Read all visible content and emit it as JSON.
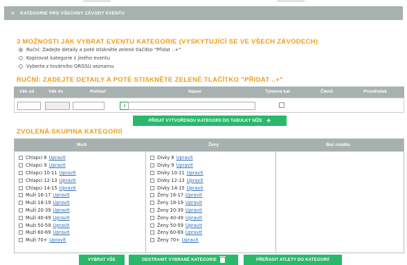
{
  "section": {
    "title": "KATEGORIE PRO VŠECHNY ZÁVODY EVENTU"
  },
  "methods": {
    "heading": "3 MOŽNOSTI JAK VYBRAT EVENTU KATEGORIE (VYSKYTUJÍCÍ SE VE VŠECH ZÁVODECH)",
    "options": [
      {
        "label": "Ruční: Zadejte detaily a poté stiskněte zelené tlačítko \"Přidat ..+\"",
        "checked": true
      },
      {
        "label": "Kopírovat kategorie z jiného eventu",
        "checked": false
      },
      {
        "label": "Vyberte z továrního ORGSU seznamu",
        "checked": false
      }
    ]
  },
  "manual": {
    "heading": "RUČNÍ: ZADEJTE DETAILY A POTÉ STISKNĚTE ZELENÉ TLAČÍTKO \"PŘIDAT ..+\"",
    "columns": [
      "Věk od",
      "Věk do",
      "Pohlaví",
      "Název",
      "Týmová kat",
      "Členů",
      "Prostředek"
    ],
    "add_button": "PŘIDAT VYTVOŘENOU KATEGORII DO TABULKY NÍŽE"
  },
  "selected": {
    "heading": "ZVOLENÁ SKUPINA KATEGORIÍ",
    "columns": [
      "Muži",
      "Ženy",
      "Bez rozdílu"
    ],
    "edit_label": "Upravit",
    "men": [
      "Chlapci 8",
      "Chlapci 9",
      "Chlapci 10-11",
      "Chlapci 12-13",
      "Chlapci 14-15",
      "Muži 16-17",
      "Muži 18-19",
      "Muži 20-39",
      "Muži 40-49",
      "Muži 50-59",
      "Muži 60-69",
      "Muži 70+"
    ],
    "women": [
      "Dívky 8",
      "Dívky 9",
      "Dívky 10-11",
      "Dívky 12-13",
      "Dívky 14-15",
      "Ženy 16-17",
      "Ženy 18-19",
      "Ženy 20-39",
      "Ženy 40-49",
      "Ženy 50-59",
      "Ženy 60-69",
      "Ženy 70+"
    ]
  },
  "actions": {
    "select_all": "VYBRAT VŠE",
    "remove_selected": "ODSTRANIT VYBRANÉ KATEGORIE",
    "reassign": "PŘEŘADIT ATLETY DO KATEGORIÍ"
  },
  "colors": {
    "accent": "#f39c12",
    "green": "#2ab86a",
    "header_gray": "#a7b1b0",
    "link": "#2a6ebb"
  }
}
